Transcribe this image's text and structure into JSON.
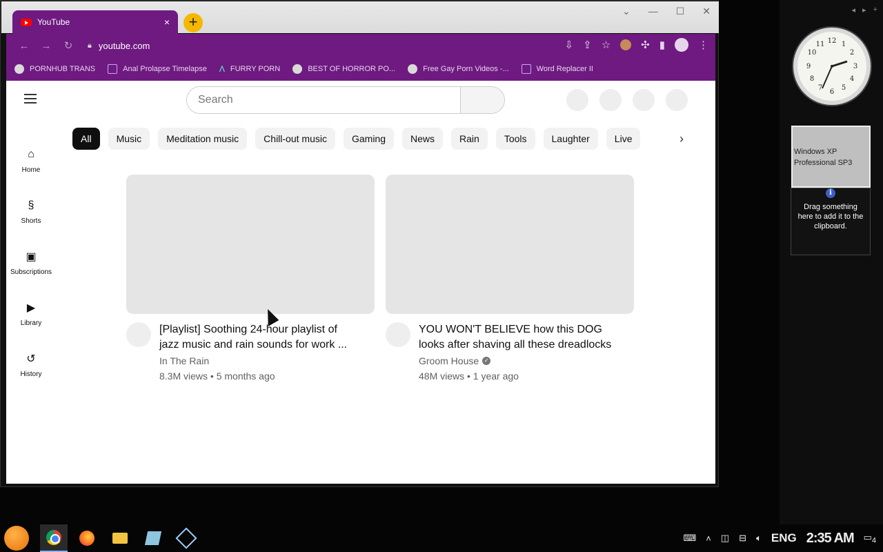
{
  "browser": {
    "tab_title": "YouTube",
    "tab_close": "×",
    "new_tab": "+",
    "url": "youtube.com",
    "window_controls": [
      "⌄",
      "—",
      "☐",
      "✕"
    ]
  },
  "bookmarks": [
    {
      "label": "PORNHUB TRANS",
      "icon": "globe-icon"
    },
    {
      "label": "Anal Prolapse Timelapse",
      "icon": "page-icon"
    },
    {
      "label": "FURRY PORN",
      "icon": "triangle-logo-icon"
    },
    {
      "label": "BEST OF HORROR PO...",
      "icon": "globe-icon"
    },
    {
      "label": "Free Gay Porn Videos -...",
      "icon": "site-icon"
    },
    {
      "label": "Word Replacer II",
      "icon": "extension-icon"
    }
  ],
  "youtube": {
    "search_placeholder": "Search",
    "chips": [
      "All",
      "Music",
      "Meditation music",
      "Chill-out music",
      "Gaming",
      "News",
      "Rain",
      "Tools",
      "Laughter",
      "Live"
    ],
    "active_chip": "All",
    "sidenav": [
      {
        "label": "Home",
        "icon": "home-icon"
      },
      {
        "label": "Shorts",
        "icon": "shorts-icon"
      },
      {
        "label": "Subscriptions",
        "icon": "subscriptions-icon"
      },
      {
        "label": "Library",
        "icon": "library-icon"
      },
      {
        "label": "History",
        "icon": "history-icon"
      }
    ],
    "videos": [
      {
        "title": "[Playlist] Soothing 24-hour playlist of jazz music and rain sounds for work ...",
        "channel": "In The Rain",
        "verified": false,
        "stats": "8.3M views • 5 months ago"
      },
      {
        "title": "YOU WON'T BELIEVE how this DOG looks after shaving all these dreadlocks",
        "channel": "Groom House",
        "verified": true,
        "stats": "48M views • 1 year ago"
      }
    ]
  },
  "gadgets": {
    "xp_label": "Windows XP Professional SP3",
    "clipboard_hint": "Drag something here to add it to the clipboard.",
    "info_glyph": "i"
  },
  "taskbar": {
    "language": "ENG",
    "time": "2:35 AM",
    "notification_count": "4"
  }
}
